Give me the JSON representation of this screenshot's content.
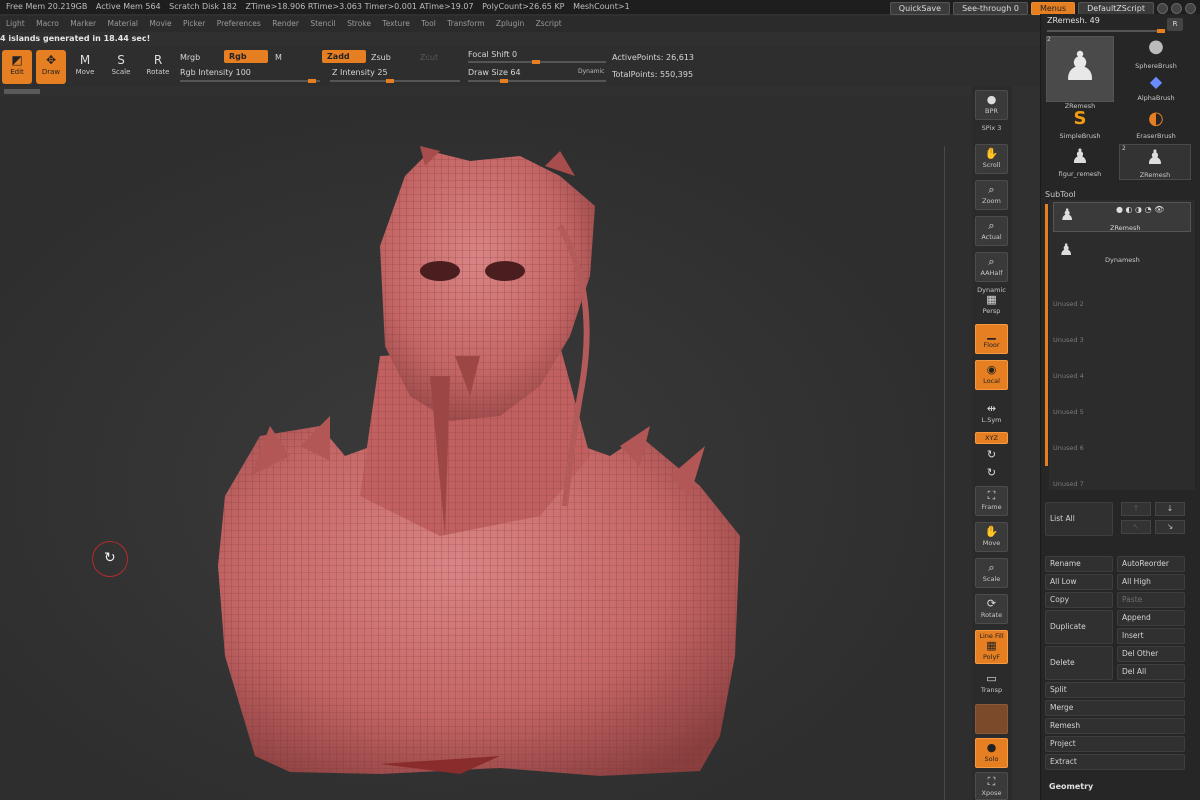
{
  "status": {
    "free_mem": "Free Mem 20.219GB",
    "active_mem": "Active Mem 564",
    "scratch_disk": "Scratch Disk 182",
    "ztime": "ZTime>18.906 RTime>3.063 Timer>0.001 ATime>19.07",
    "polycount": "PolyCount>26.65 KP",
    "meshcount": "MeshCount>1"
  },
  "topright": {
    "quicksave": "QuickSave",
    "see_through": "See-through 0",
    "menus": "Menus",
    "script": "DefaultZScript"
  },
  "menus": [
    "Light",
    "Macro",
    "Marker",
    "Material",
    "Movie",
    "Picker",
    "Preferences",
    "Render",
    "Stencil",
    "Stroke",
    "Texture",
    "Tool",
    "Transform",
    "Zplugin",
    "Zscript"
  ],
  "message": "4 islands generated in 18.44 sec!",
  "toolbar": {
    "edit": "Edit",
    "draw": "Draw",
    "move": "Move",
    "scale": "Scale",
    "rotate": "Rotate",
    "mrgb": "Mrgb",
    "rgb": "Rgb",
    "m": "M",
    "zadd": "Zadd",
    "zsub": "Zsub",
    "zcut": "Zcut",
    "rgb_intensity": "Rgb Intensity 100",
    "z_intensity": "Z Intensity 25",
    "focal_shift": "Focal Shift 0",
    "draw_size": "Draw Size 64",
    "dynamic": "Dynamic",
    "active_points": "ActivePoints: 26,613",
    "total_points": "TotalPoints: 550,395"
  },
  "shelf": {
    "bpr": "BPR",
    "spix": "SPix 3",
    "scroll": "Scroll",
    "zoom": "Zoom",
    "actual": "Actual",
    "aahalf": "AAHalf",
    "dynamic": "Dynamic",
    "persp": "Persp",
    "floor": "Floor",
    "local": "Local",
    "lsym": "L.Sym",
    "xyz": "XYZ",
    "frame": "Frame",
    "move": "Move",
    "scale": "Scale",
    "rotate": "Rotate",
    "linefill": "Line Fill",
    "polyf": "PolyF",
    "transp": "Transp",
    "solo": "Solo",
    "xpose": "Xpose"
  },
  "palette": {
    "zremesh": "ZRemesh. 49",
    "r": "R",
    "count_2a": "2",
    "count_2b": "2",
    "brushes": [
      {
        "label": "ZRemesh"
      },
      {
        "label": "SphereBrush"
      },
      {
        "label": "AlphaBrush"
      },
      {
        "label": "SimpleBrush"
      },
      {
        "label": "EraserBrush"
      },
      {
        "label": "figur_remesh"
      },
      {
        "label": "ZRemesh"
      }
    ],
    "subtool_title": "SubTool",
    "subtools": [
      "ZRemesh",
      "Dynamesh",
      "Unused 2",
      "Unused 3",
      "Unused 4",
      "Unused 5",
      "Unused 6",
      "Unused 7"
    ],
    "list_all": "List All",
    "rename": "Rename",
    "autoreorder": "AutoReorder",
    "all_low": "All Low",
    "all_high": "All High",
    "copy": "Copy",
    "paste": "Paste",
    "duplicate": "Duplicate",
    "append": "Append",
    "insert": "Insert",
    "delete": "Delete",
    "del_other": "Del Other",
    "del_all": "Del All",
    "split": "Split",
    "merge": "Merge",
    "remesh": "Remesh",
    "project": "Project",
    "extract": "Extract",
    "geometry": "Geometry"
  },
  "colors": {
    "accent": "#e67e22",
    "model": "#c46a6a",
    "background": "#303030"
  }
}
